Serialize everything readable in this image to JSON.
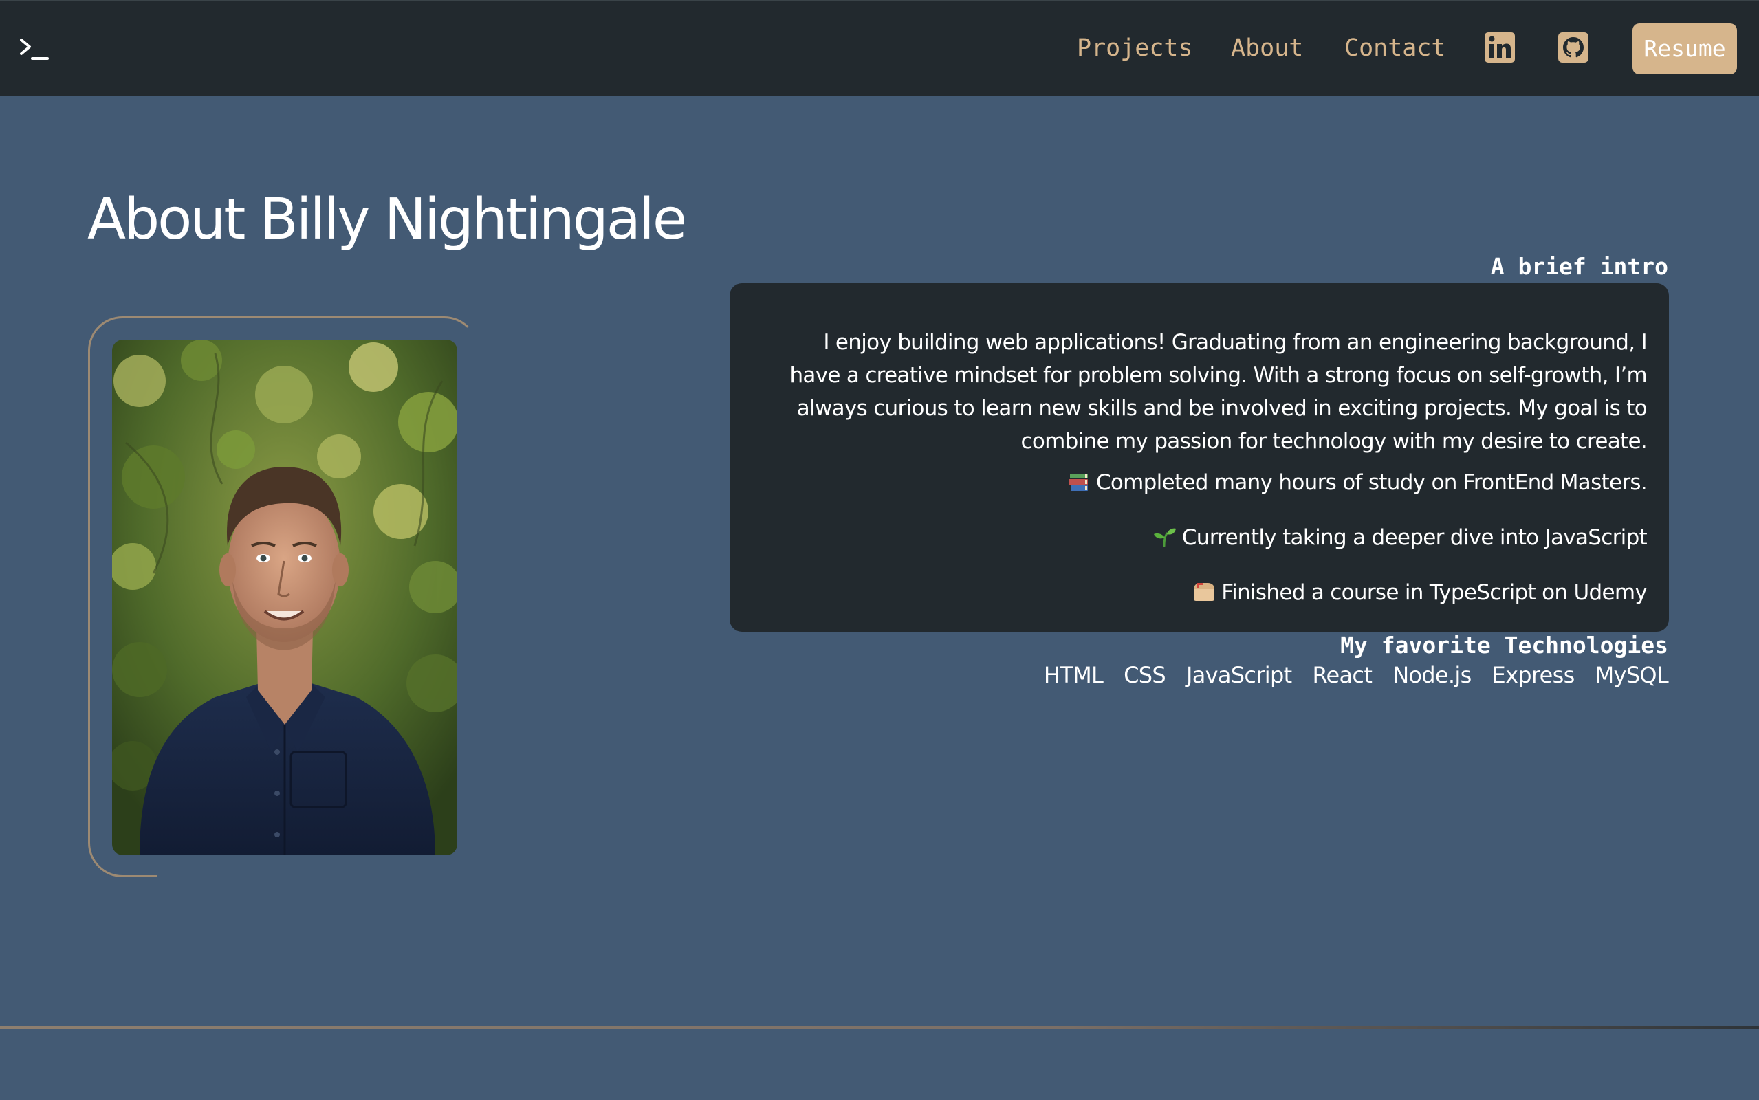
{
  "nav": {
    "logo_icon": "terminal-prompt-icon",
    "links": [
      "Projects",
      "About",
      "Contact"
    ],
    "social_icons": [
      "linkedin-icon",
      "github-icon"
    ],
    "resume_label": "Resume"
  },
  "about": {
    "title": "About Billy Nightingale",
    "intro_heading": "A brief intro",
    "intro_paragraph": "I enjoy building web applications! Graduating from an engineering background, I have a creative mindset for problem solving. With a strong focus on self-growth, I’m always curious to learn new skills and be involved in exciting projects. My goal is to combine my passion for technology with my desire to create.",
    "points": [
      {
        "icon": "books-emoji",
        "text": "Completed many hours of study on FrontEnd Masters."
      },
      {
        "icon": "seedling-emoji",
        "text": "Currently taking a deeper dive into JavaScript"
      },
      {
        "icon": "mailbox-emoji",
        "text": "Finished a course in TypeScript on Udemy"
      }
    ],
    "tech_heading": "My favorite Technologies",
    "technologies": [
      "HTML",
      "CSS",
      "JavaScript",
      "React",
      "Node.js",
      "Express",
      "MySQL"
    ]
  },
  "colors": {
    "page_background": "#435a74",
    "navbar_background": "#22292e",
    "accent": "#d6b58c",
    "card_background": "#22292e",
    "text": "#ffffff"
  }
}
